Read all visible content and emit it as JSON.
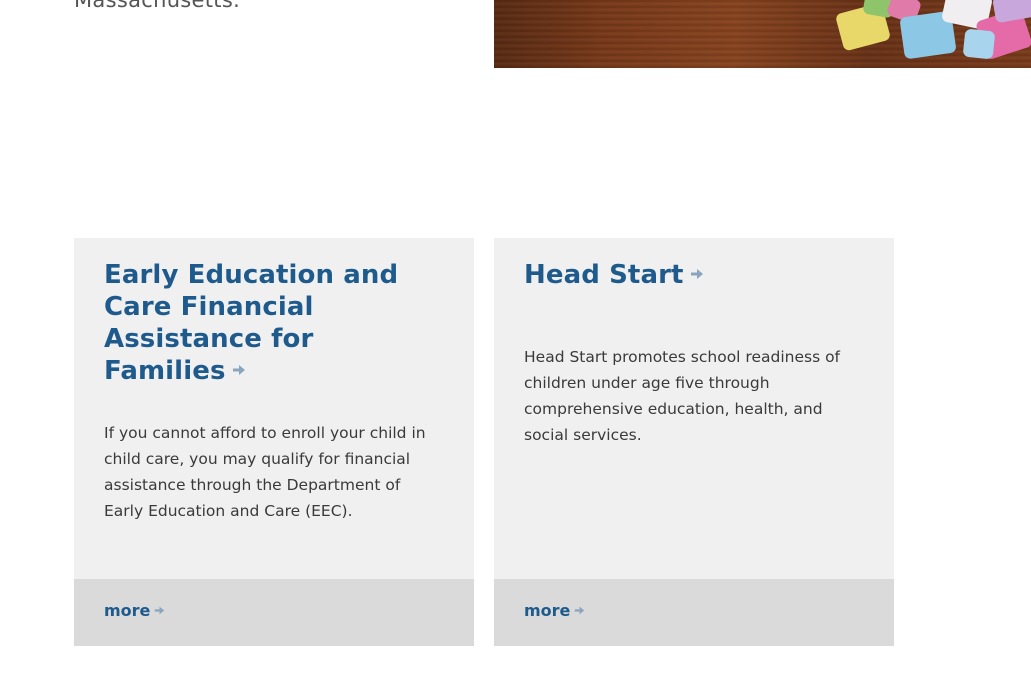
{
  "intro": {
    "text": "Massachusetts."
  },
  "hero_image": {
    "alt": "Colorful puzzle pieces on a wooden table"
  },
  "cards": [
    {
      "title": "Early Education and Care Financial Assistance for Families",
      "description": "If you cannot afford to enroll your child in child care, you may qualify for financial assistance through the Department of Early Education and Care (EEC).",
      "more_label": "more"
    },
    {
      "title": "Head Start",
      "description": "Head Start promotes school readiness of children under age five through comprehensive education, health, and social services.",
      "more_label": "more"
    }
  ],
  "colors": {
    "link": "#1e5a8c",
    "arrow": "#8aa5be",
    "card_bg": "#f0f0f0",
    "footer_bg": "#dadada",
    "body_text": "#3a3a3a"
  },
  "icons": {
    "title_arrow": "arrow-right-icon",
    "more_arrow": "arrow-right-icon"
  }
}
